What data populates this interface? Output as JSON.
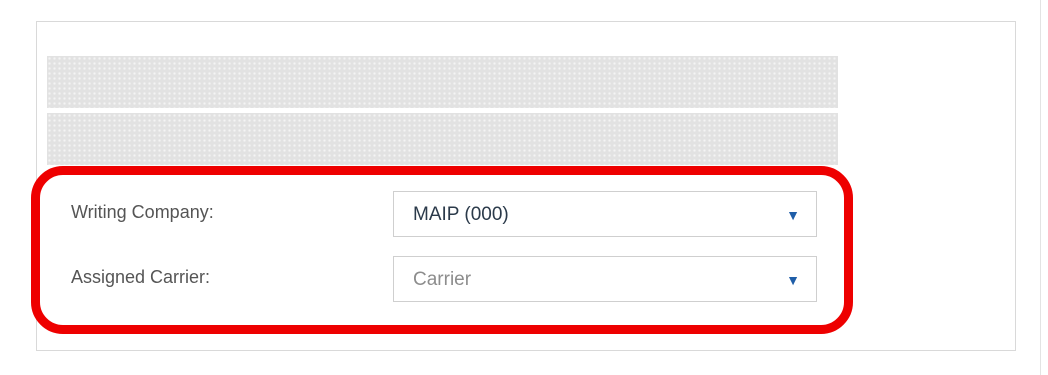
{
  "form": {
    "writing_company": {
      "label": "Writing Company:",
      "value": "MAIP (000)",
      "caret_icon": "caret-down-icon"
    },
    "assigned_carrier": {
      "label": "Assigned Carrier:",
      "placeholder": "Carrier",
      "caret_icon": "caret-down-icon"
    }
  },
  "icons": {
    "caret": "▼"
  },
  "colors": {
    "highlight": "#ee0000",
    "caret": "#1f5ea8"
  }
}
